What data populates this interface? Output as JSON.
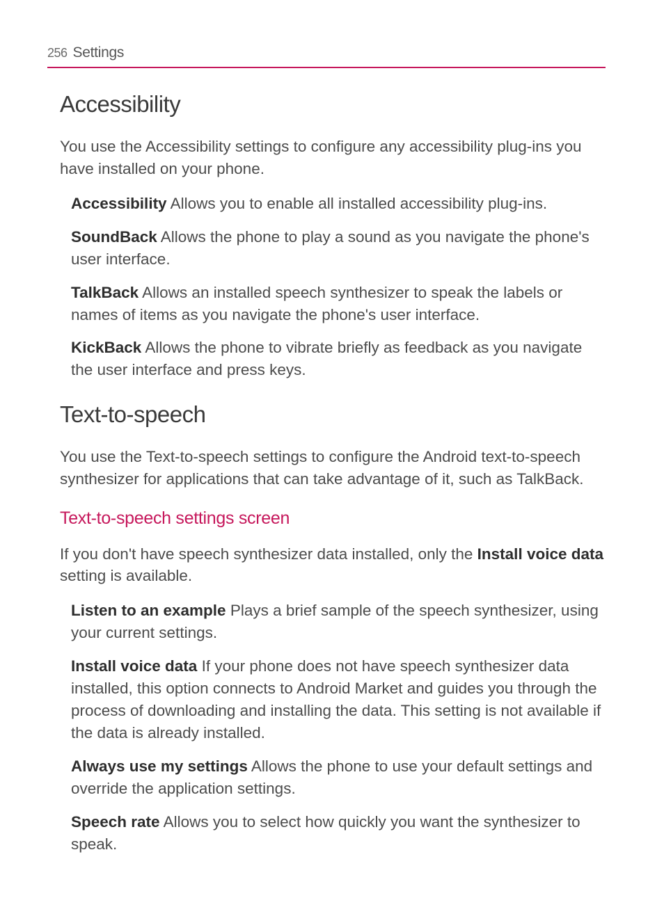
{
  "header": {
    "page_number": "256",
    "section": "Settings"
  },
  "sections": {
    "accessibility": {
      "title": "Accessibility",
      "intro": "You use the Accessibility settings to configure any accessibility plug-ins you have installed on your phone.",
      "items": [
        {
          "label": "Accessibility",
          "desc": " Allows you to enable all installed accessibility plug-ins."
        },
        {
          "label": "SoundBack",
          "desc": " Allows the phone to play a sound as you navigate the phone's user interface."
        },
        {
          "label": "TalkBack",
          "desc": " Allows an installed speech synthesizer to speak the labels or names of items as you navigate the phone's user interface."
        },
        {
          "label": "KickBack",
          "desc": " Allows the phone to vibrate briefly as feedback as you navigate the user interface and press keys."
        }
      ]
    },
    "tts": {
      "title": "Text-to-speech",
      "intro": "You use the Text-to-speech settings to configure the Android text-to-speech synthesizer for applications that can take advantage of it, such as TalkBack.",
      "subheading": "Text-to-speech settings screen",
      "sub_intro_pre": "If you don't have speech synthesizer data installed, only the ",
      "sub_intro_bold": "Install voice data",
      "sub_intro_post": " setting is available.",
      "items": [
        {
          "label": "Listen to an example",
          "desc": " Plays a brief sample of the speech synthesizer, using your current settings."
        },
        {
          "label": "Install voice data",
          "desc": " If your phone does not have speech synthesizer data installed, this option connects to Android Market and guides you through the process of downloading and installing the data. This setting is not available if the data is already installed."
        },
        {
          "label": "Always use my settings",
          "desc": " Allows the phone to use your default settings and override the application settings."
        },
        {
          "label": "Speech rate",
          "desc": " Allows you to select how quickly you want the synthesizer to speak."
        }
      ]
    }
  }
}
